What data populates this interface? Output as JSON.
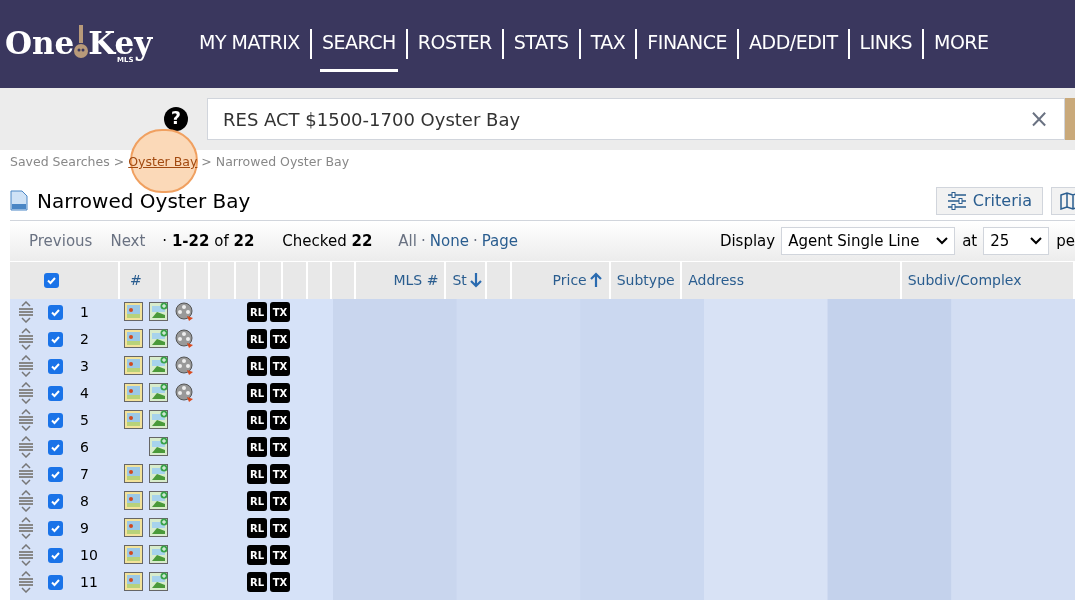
{
  "logo": {
    "left": "One",
    "right": "Key",
    "sub": "MLS"
  },
  "nav": [
    {
      "label": "MY MATRIX",
      "selected": false
    },
    {
      "label": "SEARCH",
      "selected": true
    },
    {
      "label": "ROSTER",
      "selected": false
    },
    {
      "label": "STATS",
      "selected": false
    },
    {
      "label": "TAX",
      "selected": false
    },
    {
      "label": "FINANCE",
      "selected": false
    },
    {
      "label": "ADD/EDIT",
      "selected": false
    },
    {
      "label": "LINKS",
      "selected": false
    },
    {
      "label": "MORE",
      "selected": false
    }
  ],
  "help": "?",
  "search": {
    "value": "RES ACT $1500-1700 Oyster Bay",
    "clear": "×"
  },
  "breadcrumb": [
    {
      "label": "Saved Searches",
      "link": false
    },
    {
      "label": "Oyster Bay",
      "link": true
    },
    {
      "label": "Narrowed Oyster Bay",
      "link": false
    }
  ],
  "breadcrumb_sep": ">",
  "title": "Narrowed Oyster Bay",
  "buttons": {
    "criteria": "Criteria"
  },
  "pager": {
    "previous": "Previous",
    "next": "Next",
    "range": "· **1-22** of **22**",
    "checked": "Checked **22**",
    "dot": "·",
    "select": [
      {
        "label": "All",
        "disabled": true
      },
      {
        "label": "None",
        "disabled": false
      },
      {
        "label": "Page",
        "disabled": false
      }
    ],
    "display_label": "Display",
    "display_value": "Agent Single Line",
    "at_label": "at",
    "per_value": "25",
    "per_label": "pe"
  },
  "header": {
    "all_checked": true,
    "columns": [
      {
        "label": "#",
        "kind": "plain"
      },
      {
        "label": "MLS #",
        "kind": "plain"
      },
      {
        "label": "St",
        "kind": "descending"
      },
      {
        "label": "Price",
        "kind": "ascending"
      },
      {
        "label": "Subtype",
        "kind": "plain"
      },
      {
        "label": "Address",
        "kind": "plain"
      },
      {
        "label": "Subdiv/Complex",
        "kind": "plain"
      }
    ]
  },
  "rows": [
    {
      "num": "1",
      "checked": true,
      "photo": true,
      "gallery": true,
      "video": true,
      "badges": [
        "RL",
        "TX"
      ]
    },
    {
      "num": "2",
      "checked": true,
      "photo": true,
      "gallery": true,
      "video": true,
      "badges": [
        "RL",
        "TX"
      ]
    },
    {
      "num": "3",
      "checked": true,
      "photo": true,
      "gallery": true,
      "video": true,
      "badges": [
        "RL",
        "TX"
      ]
    },
    {
      "num": "4",
      "checked": true,
      "photo": true,
      "gallery": true,
      "video": true,
      "badges": [
        "RL",
        "TX"
      ]
    },
    {
      "num": "5",
      "checked": true,
      "photo": true,
      "gallery": true,
      "video": false,
      "badges": [
        "RL",
        "TX"
      ]
    },
    {
      "num": "6",
      "checked": true,
      "photo": false,
      "gallery": true,
      "video": false,
      "badges": [
        "RL",
        "TX"
      ]
    },
    {
      "num": "7",
      "checked": true,
      "photo": true,
      "gallery": true,
      "video": false,
      "badges": [
        "RL",
        "TX"
      ]
    },
    {
      "num": "8",
      "checked": true,
      "photo": true,
      "gallery": true,
      "video": false,
      "badges": [
        "RL",
        "TX"
      ]
    },
    {
      "num": "9",
      "checked": true,
      "photo": true,
      "gallery": true,
      "video": false,
      "badges": [
        "RL",
        "TX"
      ]
    },
    {
      "num": "10",
      "checked": true,
      "photo": true,
      "gallery": true,
      "video": false,
      "badges": [
        "RL",
        "TX"
      ]
    },
    {
      "num": "11",
      "checked": true,
      "photo": true,
      "gallery": true,
      "video": false,
      "badges": [
        "RL",
        "TX"
      ]
    }
  ]
}
